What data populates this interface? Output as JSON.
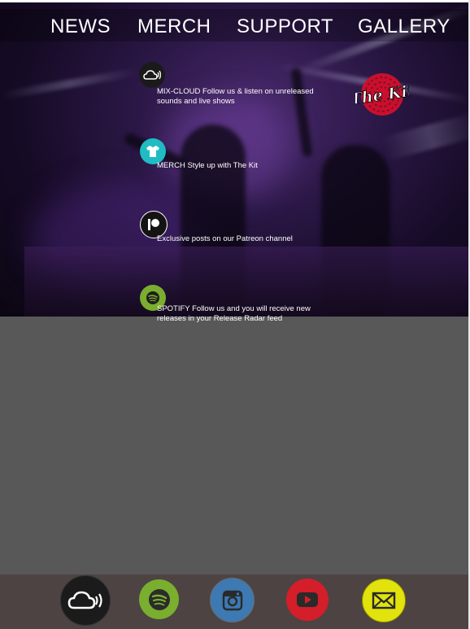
{
  "nav": {
    "items": [
      {
        "label": "NEWS"
      },
      {
        "label": "MERCH"
      },
      {
        "label": "SUPPORT"
      },
      {
        "label": "GALLERY"
      }
    ]
  },
  "logo": {
    "text": "The Kit",
    "colors": {
      "badge": "#c8102e",
      "text": "#ffffff"
    }
  },
  "features": [
    {
      "icon": "mixcloud-icon",
      "text": "MIX-CLOUD Follow us & listen on unreleased sounds and live shows",
      "icon_bg": "#1a1a1a"
    },
    {
      "icon": "merch-shirt-icon",
      "text": "MERCH Style up with The Kit",
      "icon_bg": "#1fbcc3"
    },
    {
      "icon": "patreon-icon",
      "text": "Exclusive posts on our Patreon channel",
      "icon_bg": "#141414"
    },
    {
      "icon": "spotify-icon",
      "text": "SPOTIFY Follow us and you will receive new releases in your Release Radar feed",
      "icon_bg": "#7aae2e"
    }
  ],
  "footer": {
    "social": [
      {
        "icon": "mixcloud-icon",
        "color": "#1b1b1b"
      },
      {
        "icon": "spotify-icon",
        "color": "#7aae2e"
      },
      {
        "icon": "instagram-icon",
        "color": "#3d79b2"
      },
      {
        "icon": "youtube-icon",
        "color": "#d41e2a"
      },
      {
        "icon": "email-icon",
        "color": "#e2e20d"
      }
    ]
  },
  "colors": {
    "lower_panel": "#585858",
    "footer_bar": "#4c4342"
  }
}
